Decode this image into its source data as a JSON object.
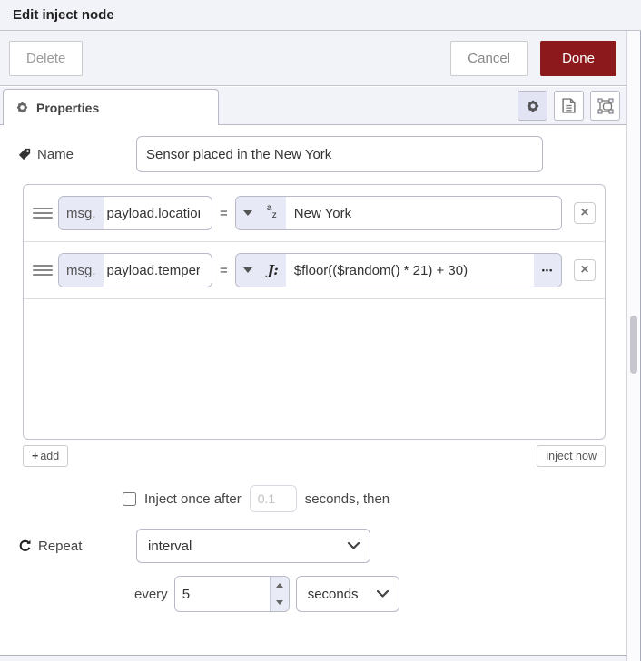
{
  "window": {
    "title": "Edit inject node"
  },
  "actions": {
    "delete": "Delete",
    "cancel": "Cancel",
    "done": "Done"
  },
  "tabbar": {
    "properties": "Properties"
  },
  "name_row": {
    "label": "Name",
    "value": "Sensor placed in the New York"
  },
  "rules": [
    {
      "prefix": "msg.",
      "key": "payload.location",
      "equals": "=",
      "type": "string",
      "az_top": "a",
      "az_bottom": "z",
      "value": "New York",
      "remove": "×"
    },
    {
      "prefix": "msg.",
      "key": "payload.temperature",
      "equals": "=",
      "type": "jsonata-expression",
      "glyph": "J:",
      "value": "$floor(($random() * 21) + 30)",
      "ellipsis": "•••",
      "remove": "×"
    }
  ],
  "list_footer": {
    "add_plus": "+",
    "add": "add",
    "inject_now": "inject now"
  },
  "once_row": {
    "label": "Inject once after",
    "delay": "0.1",
    "suffix": "seconds, then"
  },
  "repeat_row": {
    "label": "Repeat",
    "selected": "interval"
  },
  "every_row": {
    "label": "every",
    "value": "5",
    "unit": "seconds"
  },
  "colors": {
    "done_bg": "#8c1a1c",
    "panel_bg": "#f2f2f9",
    "pill_bg": "#e7e9f7"
  }
}
